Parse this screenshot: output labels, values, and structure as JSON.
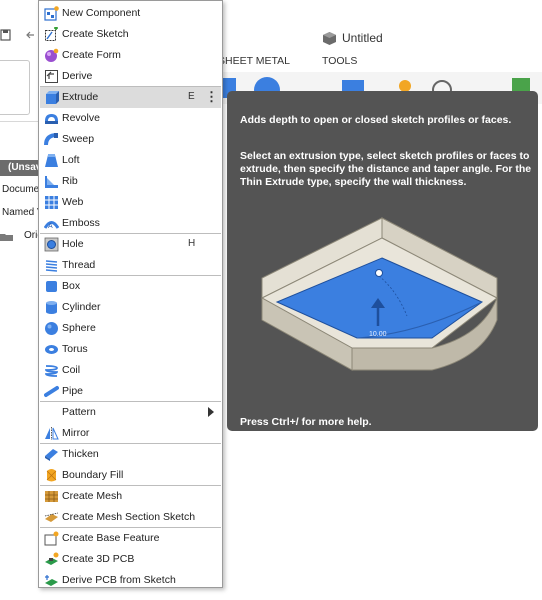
{
  "app": {
    "title": "Untitled",
    "tabs": [
      "SHEET METAL",
      "TOOLS"
    ],
    "browser": {
      "header": "(Unsaved)",
      "rows": [
        "Document Settings",
        "Named Views",
        "Origin"
      ]
    }
  },
  "menu": {
    "items": [
      {
        "label": "New Component",
        "icon": "new-component-icon"
      },
      {
        "label": "Create Sketch",
        "icon": "create-sketch-icon"
      },
      {
        "label": "Create Form",
        "icon": "create-form-icon"
      },
      {
        "label": "Derive",
        "icon": "derive-icon"
      },
      {
        "label": "Extrude",
        "icon": "extrude-icon",
        "shortcut": "E",
        "highlighted": true
      },
      {
        "label": "Revolve",
        "icon": "revolve-icon"
      },
      {
        "label": "Sweep",
        "icon": "sweep-icon"
      },
      {
        "label": "Loft",
        "icon": "loft-icon"
      },
      {
        "label": "Rib",
        "icon": "rib-icon"
      },
      {
        "label": "Web",
        "icon": "web-icon"
      },
      {
        "label": "Emboss",
        "icon": "emboss-icon"
      },
      {
        "label": "Hole",
        "icon": "hole-icon",
        "shortcut": "H"
      },
      {
        "label": "Thread",
        "icon": "thread-icon"
      },
      {
        "label": "Box",
        "icon": "box-icon"
      },
      {
        "label": "Cylinder",
        "icon": "cylinder-icon"
      },
      {
        "label": "Sphere",
        "icon": "sphere-icon"
      },
      {
        "label": "Torus",
        "icon": "torus-icon"
      },
      {
        "label": "Coil",
        "icon": "coil-icon"
      },
      {
        "label": "Pipe",
        "icon": "pipe-icon"
      },
      {
        "label": "Pattern",
        "icon": "",
        "submenu": true
      },
      {
        "label": "Mirror",
        "icon": "mirror-icon"
      },
      {
        "label": "Thicken",
        "icon": "thicken-icon"
      },
      {
        "label": "Boundary Fill",
        "icon": "boundary-fill-icon"
      },
      {
        "label": "Create Mesh",
        "icon": "create-mesh-icon"
      },
      {
        "label": "Create Mesh Section Sketch",
        "icon": "mesh-section-sketch-icon"
      },
      {
        "label": "Create Base Feature",
        "icon": "base-feature-icon"
      },
      {
        "label": "Create 3D PCB",
        "icon": "3d-pcb-icon"
      },
      {
        "label": "Derive PCB from Sketch",
        "icon": "derive-pcb-icon"
      }
    ]
  },
  "tooltip": {
    "title": "Adds depth to open or closed sketch profiles or faces.",
    "body": "Select an extrusion type, select sketch profiles or faces to extrude, then specify the distance and taper angle. For the Thin Extrude type, specify the wall thickness.",
    "illustration_value": "10.00",
    "footer": "Press Ctrl+/ for more help."
  },
  "colors": {
    "tooltip_bg": "#545454",
    "menu_highlight": "#dcdcdc",
    "extrude_blue": "#3b7fe0"
  }
}
